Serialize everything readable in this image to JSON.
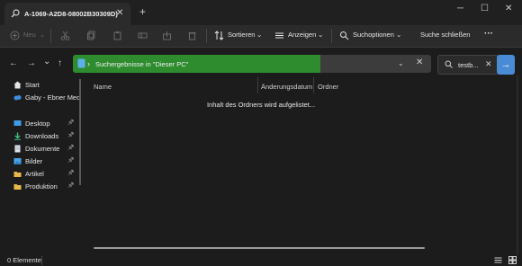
{
  "window": {
    "tab_title": "A-1069-A2D8-08002B30309D}",
    "tab_close": "✕",
    "new_tab": "+",
    "minimize": "─",
    "maximize": "☐",
    "close": "✕"
  },
  "toolbar": {
    "new_label": "Neu",
    "sort_label": "Sortieren",
    "view_label": "Anzeigen",
    "search_options_label": "Suchoptionen",
    "close_search_label": "Suche schließen",
    "more_label": "···"
  },
  "nav": {
    "back": "←",
    "forward": "→",
    "recent": "⌄",
    "up": "↑"
  },
  "address": {
    "chevron": "›",
    "text": "Suchergebnisse in \"Dieser PC\"",
    "dropdown": "⌄",
    "clear": "✕",
    "progress_fraction": 0.69,
    "progress_color": "#2e8b2e"
  },
  "search": {
    "value": "testb...",
    "clear": "✕",
    "go": "→"
  },
  "sidebar": {
    "items": [
      {
        "label": "Start",
        "icon": "home-icon"
      },
      {
        "label": "Gaby - Ebner Med",
        "icon": "cloud-user-icon"
      },
      {
        "label": "Desktop",
        "icon": "desktop-icon",
        "pinned": true
      },
      {
        "label": "Downloads",
        "icon": "download-icon",
        "pinned": true
      },
      {
        "label": "Dokumente",
        "icon": "document-icon",
        "pinned": true
      },
      {
        "label": "Bilder",
        "icon": "pictures-icon",
        "pinned": true
      },
      {
        "label": "Artikel",
        "icon": "folder-icon",
        "pinned": true
      },
      {
        "label": "Produktion",
        "icon": "folder-icon",
        "pinned": true
      }
    ],
    "pin_glyph": "📌"
  },
  "columns": {
    "name": "Name",
    "date": "Änderungsdatum",
    "folder": "Ordner"
  },
  "content": {
    "loading_text": "Inhalt des Ordners wird aufgelistet..."
  },
  "status": {
    "count": "0 Elemente"
  }
}
